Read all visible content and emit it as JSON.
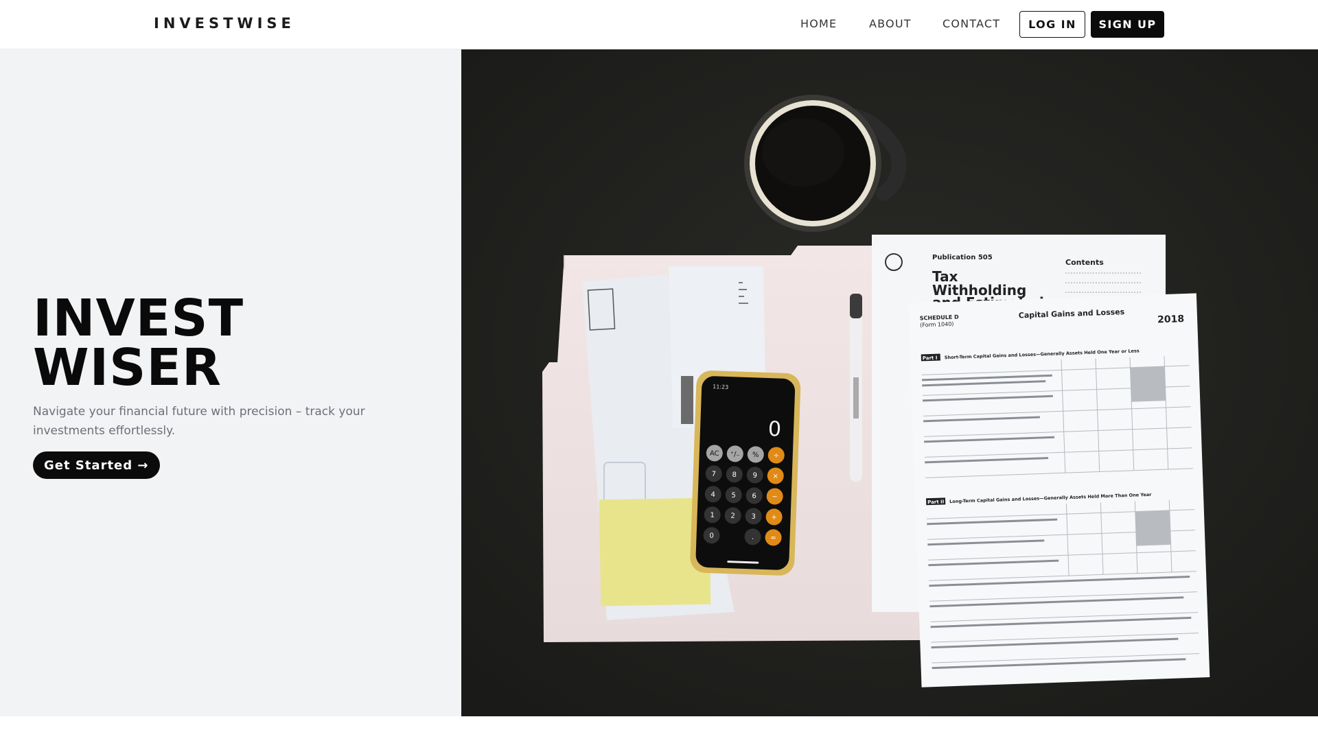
{
  "header": {
    "brand": "INVESTWISE",
    "nav": {
      "home": "HOME",
      "about": "ABOUT",
      "contact": "CONTACT"
    },
    "login_label": "LOG IN",
    "signup_label": "SIGN UP"
  },
  "hero": {
    "title_line1": "INVEST",
    "title_line2": "WISER",
    "subtitle": "Navigate your financial future with precision – track your investments effortlessly.",
    "cta_label": "Get Started →"
  },
  "photo": {
    "calculator_display": "0",
    "calculator_time": "11:23",
    "calculator_keys": [
      "AC",
      "⁺∕₋",
      "%",
      "÷",
      "7",
      "8",
      "9",
      "×",
      "4",
      "5",
      "6",
      "−",
      "1",
      "2",
      "3",
      "+",
      "0",
      ".",
      "="
    ],
    "publication_label": "Publication 505",
    "publication_title_1": "Tax",
    "publication_title_2": "Withholding",
    "publication_title_3": "and Estimated",
    "contents_label": "Contents",
    "schedule_label": "SCHEDULE D",
    "schedule_form": "(Form 1040)",
    "schedule_title": "Capital Gains and Losses",
    "schedule_year": "2018",
    "part1": "Part I",
    "part1_title": "Short-Term Capital Gains and Losses—Generally Assets Held One Year or Less",
    "part2": "Part II",
    "part2_title": "Long-Term Capital Gains and Losses—Generally Assets Held More Than One Year",
    "colors": {
      "background": "#1f1f1d",
      "folder": "#eee2e2",
      "sticky": "#e8e48c",
      "accent_orange": "#e08a17"
    }
  }
}
